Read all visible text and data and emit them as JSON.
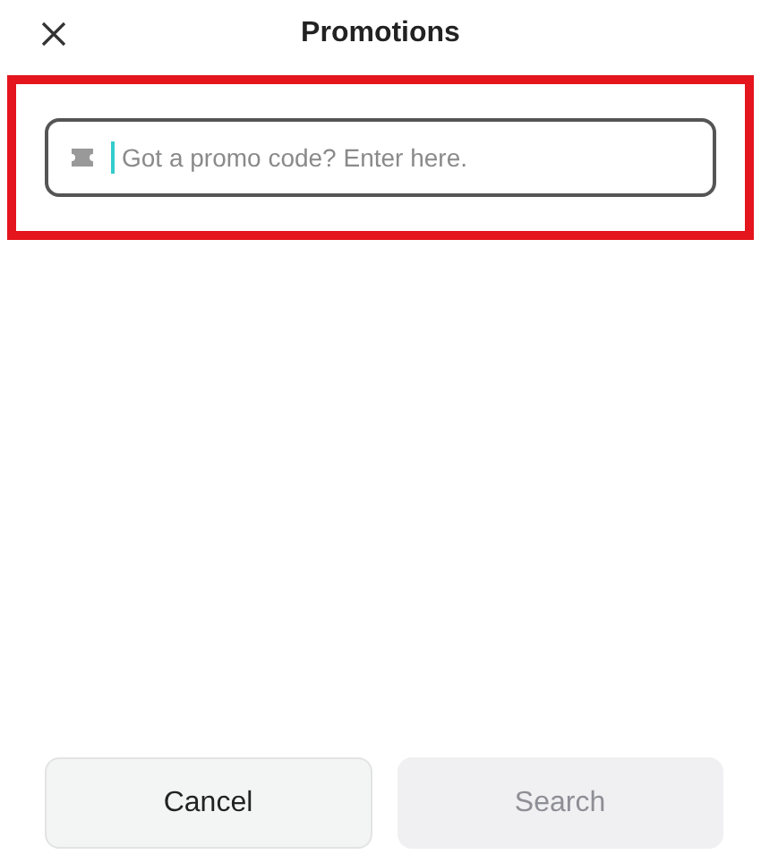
{
  "header": {
    "title": "Promotions"
  },
  "promo_field": {
    "placeholder": "Got a promo code? Enter here.",
    "highlighted": true
  },
  "buttons": [
    {
      "label": "Cancel",
      "disabled": false
    },
    {
      "label": "Search",
      "disabled": true
    }
  ]
}
